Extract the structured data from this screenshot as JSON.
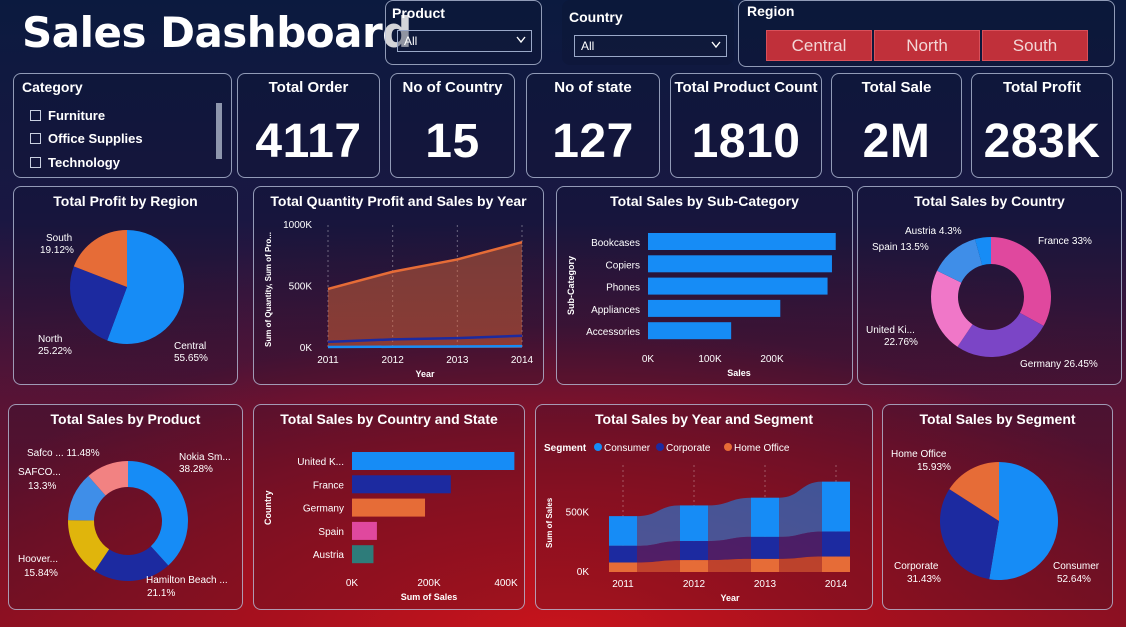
{
  "title": "Sales Dashboard",
  "slicers": {
    "product": {
      "label": "Product",
      "value": "All"
    },
    "country": {
      "label": "Country",
      "value": "All"
    },
    "region": {
      "label": "Region",
      "options": [
        "Central",
        "North",
        "South"
      ]
    },
    "category": {
      "label": "Category",
      "items": [
        "Furniture",
        "Office Supplies",
        "Technology"
      ]
    }
  },
  "kpis": [
    {
      "label": "Total Order",
      "value": "4117"
    },
    {
      "label": "No of Country",
      "value": "15"
    },
    {
      "label": "No of state",
      "value": "127"
    },
    {
      "label": "Total Product Count",
      "value": "1810"
    },
    {
      "label": "Total Sale",
      "value": "2M"
    },
    {
      "label": "Total Profit",
      "value": "283K"
    }
  ],
  "colors": {
    "blue": "#168cf6",
    "navy": "#1c2aa0",
    "orange": "#e66c37",
    "purple": "#7b45c6",
    "pink": "#f077c8",
    "magenta": "#e0489e",
    "yellow": "#e0b50c",
    "salmon": "#f28282",
    "teal": "#2e7c7a",
    "region_btn": "#c0303a"
  },
  "chart_data": [
    {
      "type": "pie",
      "title": "Total Profit by Region",
      "slices": [
        {
          "label": "Central",
          "pct_label": "55.65%",
          "value": 55.65,
          "color": "#168cf6"
        },
        {
          "label": "North",
          "pct_label": "25.22%",
          "value": 25.22,
          "color": "#1c2aa0"
        },
        {
          "label": "South",
          "pct_label": "19.12%",
          "value": 19.12,
          "color": "#e66c37"
        }
      ]
    },
    {
      "type": "area",
      "title": "Total Quantity Profit and Sales by Year",
      "xlabel": "Year",
      "ylabel": "Sum of Quantity, Sum of Pro...",
      "categories": [
        "2011",
        "2012",
        "2013",
        "2014"
      ],
      "yticks": [
        "0K",
        "500K",
        "1000K"
      ],
      "ylim": [
        0,
        1000000
      ],
      "series": [
        {
          "values": [
            480000,
            620000,
            720000,
            860000
          ],
          "color": "#e66c37"
        },
        {
          "values": [
            50000,
            70000,
            80000,
            100000
          ],
          "color": "#1c2aa0"
        },
        {
          "values": [
            8000,
            10000,
            12000,
            15000
          ],
          "color": "#168cf6"
        }
      ]
    },
    {
      "type": "bar",
      "title": "Total Sales by Sub-Category",
      "xlabel": "Sales",
      "ylabel": "Sub-Category",
      "categories": [
        "Bookcases",
        "Copiers",
        "Phones",
        "Appliances",
        "Accessories"
      ],
      "values": [
        298000,
        292000,
        285000,
        210000,
        132000
      ],
      "xticks": [
        "0K",
        "100K",
        "200K"
      ],
      "xmax": 300000,
      "color": "#168cf6"
    },
    {
      "type": "pie",
      "title": "Total Sales by Country",
      "donut": true,
      "slices": [
        {
          "label": "France 33%",
          "value": 33,
          "color": "#e0489e"
        },
        {
          "label": "Germany 26.45%",
          "value": 26.45,
          "color": "#7b45c6"
        },
        {
          "label": "United Ki...",
          "pct_label": "22.76%",
          "value": 22.76,
          "color": "#f077c8"
        },
        {
          "label": "Spain 13.5%",
          "value": 13.5,
          "color": "#3f8ee8"
        },
        {
          "label": "Austria 4.3%",
          "value": 4.3,
          "color": "#168cf6"
        }
      ]
    },
    {
      "type": "pie",
      "title": "Total Sales by Product",
      "donut": true,
      "slices": [
        {
          "label": "Nokia Sm...",
          "pct_label": "38.28%",
          "value": 38.28,
          "color": "#168cf6"
        },
        {
          "label": "Hamilton Beach ...",
          "pct_label": "21.1%",
          "value": 21.1,
          "color": "#1c2aa0"
        },
        {
          "label": "Hoover...",
          "pct_label": "15.84%",
          "value": 15.84,
          "color": "#e0b50c"
        },
        {
          "label": "SAFCO...",
          "pct_label": "13.3%",
          "value": 13.3,
          "color": "#3f8ee8"
        },
        {
          "label": "Safco ... 11.48%",
          "value": 11.48,
          "color": "#f28282"
        }
      ]
    },
    {
      "type": "bar",
      "title": "Total Sales by Country and State",
      "xlabel": "Sum of Sales",
      "ylabel": "Country",
      "categories": [
        "United K...",
        "France",
        "Germany",
        "Spain",
        "Austria"
      ],
      "values": [
        378000,
        230000,
        170000,
        58000,
        50000
      ],
      "xticks": [
        "0K",
        "200K",
        "400K"
      ],
      "xmax": 440000,
      "colors": [
        "#168cf6",
        "#1c2aa0",
        "#e66c37",
        "#e0489e",
        "#2e7c7a"
      ]
    },
    {
      "type": "area",
      "title": "Total Sales by Year and Segment",
      "xlabel": "Year",
      "ylabel": "Sum of Sales",
      "legend_title": "Segment",
      "categories": [
        "2011",
        "2012",
        "2013",
        "2014"
      ],
      "yticks": [
        "0K",
        "500K"
      ],
      "ylim": [
        0,
        900000
      ],
      "series": [
        {
          "name": "Consumer",
          "values": [
            250000,
            300000,
            330000,
            420000
          ],
          "color": "#168cf6"
        },
        {
          "name": "Corporate",
          "values": [
            140000,
            160000,
            185000,
            210000
          ],
          "color": "#1c2aa0"
        },
        {
          "name": "Home Office",
          "values": [
            80000,
            100000,
            110000,
            130000
          ],
          "color": "#e66c37"
        }
      ]
    },
    {
      "type": "pie",
      "title": "Total Sales by Segment",
      "slices": [
        {
          "label": "Consumer",
          "pct_label": "52.64%",
          "value": 52.64,
          "color": "#168cf6"
        },
        {
          "label": "Corporate",
          "pct_label": "31.43%",
          "value": 31.43,
          "color": "#1c2aa0"
        },
        {
          "label": "Home Office",
          "pct_label": "15.93%",
          "value": 15.93,
          "color": "#e66c37"
        }
      ]
    }
  ]
}
